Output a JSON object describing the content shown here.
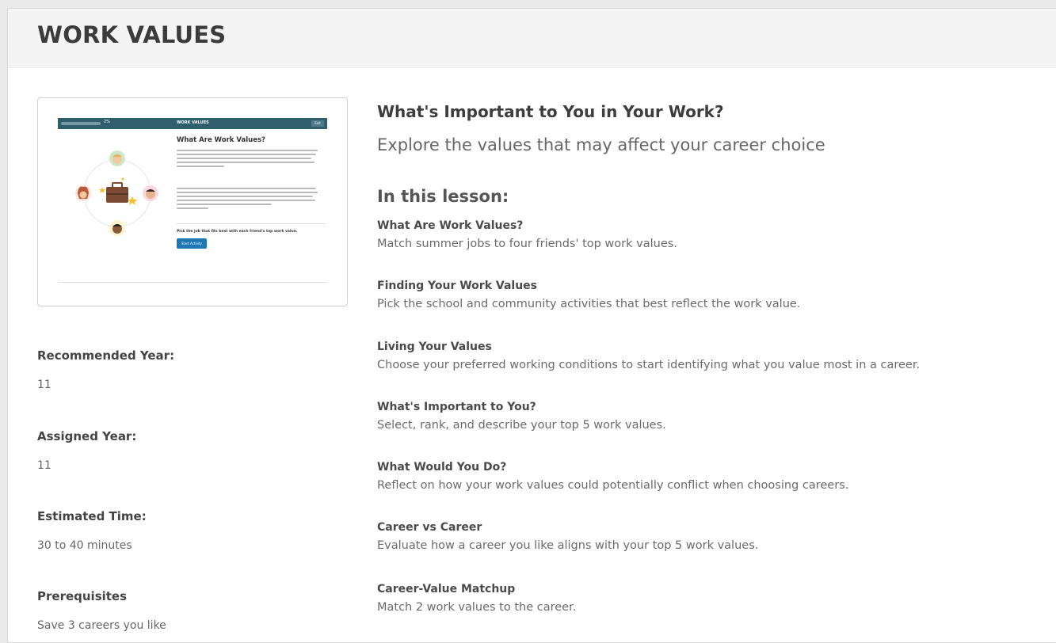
{
  "modal": {
    "title": "WORK VALUES"
  },
  "preview": {
    "percent": "2%",
    "bar_title": "WORK VALUES",
    "exit_label": "Exit",
    "heading": "What Are Work Values?",
    "prompt": "Pick the job that fits best with each friend's top work value.",
    "start_label": "Start Activity"
  },
  "meta": {
    "recommended_year_label": "Recommended Year:",
    "recommended_year_value": "11",
    "assigned_year_label": "Assigned Year:",
    "assigned_year_value": "11",
    "estimated_time_label": "Estimated Time:",
    "estimated_time_value": "30 to 40 minutes",
    "prerequisites_label": "Prerequisites",
    "prerequisites_value": "Save 3 careers you like"
  },
  "content": {
    "headline": "What's Important to You in Your Work?",
    "subhead": "Explore the values that may affect your career choice",
    "lesson_heading": "In this lesson:",
    "lessons": [
      {
        "title": "What Are Work Values?",
        "desc": "Match summer jobs to four friends' top work values."
      },
      {
        "title": "Finding Your Work Values",
        "desc": "Pick the school and community activities that best reflect the work value."
      },
      {
        "title": "Living Your Values",
        "desc": "Choose your preferred working conditions to start identifying what you value most in a career."
      },
      {
        "title": "What's Important to You?",
        "desc": "Select, rank, and describe your top 5 work values."
      },
      {
        "title": "What Would You Do?",
        "desc": "Reflect on how your work values could potentially conflict when choosing careers."
      },
      {
        "title": "Career vs Career",
        "desc": "Evaluate how a career you like aligns with your top 5 work values."
      },
      {
        "title": "Career-Value Matchup",
        "desc": "Match 2 work values to the career."
      }
    ]
  },
  "colors": {
    "header_bg": "#f4f4f4",
    "preview_bar": "#2f5f6e",
    "start_button": "#1d77b5"
  }
}
